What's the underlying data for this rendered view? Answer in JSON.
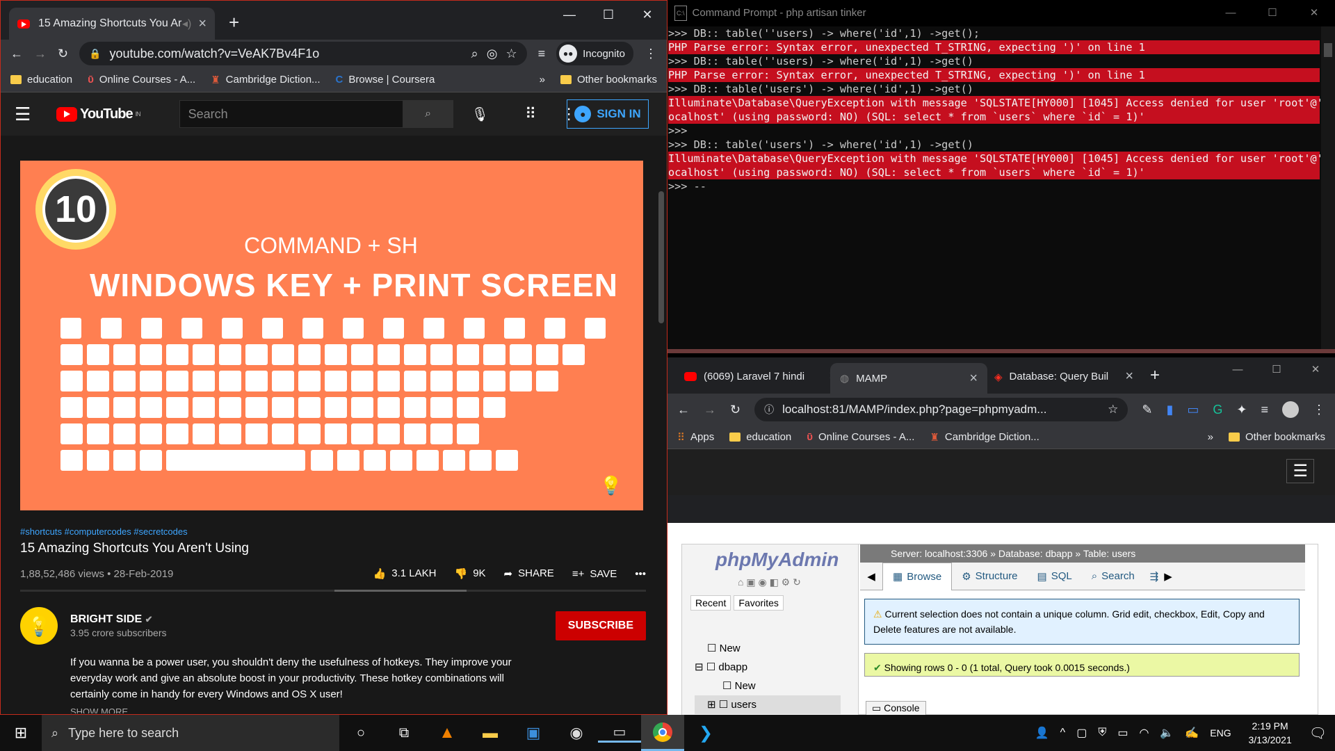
{
  "youtube_window": {
    "tab_title": "15 Amazing Shortcuts You Ar",
    "url": "youtube.com/watch?v=VeAK7Bv4F1o",
    "incognito_label": "Incognito",
    "bookmarks": [
      "education",
      "Online Courses - A...",
      "Cambridge Diction...",
      "Browse | Coursera"
    ],
    "other_bookmarks": "Other bookmarks",
    "yt_logo": "YouTube",
    "yt_region": "IN",
    "search_placeholder": "Search",
    "signin": "SIGN IN",
    "thumb": {
      "badge": "10",
      "line1": "COMMAND + SH",
      "line2": "WINDOWS KEY + PRINT SCREEN"
    },
    "hashtags": "#shortcuts #computercodes #secretcodes",
    "title": "15 Amazing Shortcuts You Aren't Using",
    "meta": "1,88,52,486 views • 28-Feb-2019",
    "likes": "3.1 LAKH",
    "dislikes": "9K",
    "share": "SHARE",
    "save": "SAVE",
    "channel": "BRIGHT SIDE",
    "subs": "3.95 crore subscribers",
    "subscribe": "SUBSCRIBE",
    "desc": "If you wanna be a power user, you shouldn't deny the usefulness of hotkeys. They improve your everyday work and give an absolute boost in your productivity. These hotkey combinations will certainly come in handy for every Windows and OS X user!",
    "show_more": "SHOW MORE"
  },
  "cmd_window": {
    "title": "Command Prompt - php  artisan tinker",
    "lines": [
      {
        "t": ">>> DB:: table(''users) -> where('id',1) ->get();",
        "e": false
      },
      {
        "t": "PHP Parse error: Syntax error, unexpected T_STRING, expecting ')' on line 1",
        "e": true
      },
      {
        "t": ">>> DB:: table(''users) -> where('id',1) ->get()",
        "e": false
      },
      {
        "t": "PHP Parse error: Syntax error, unexpected T_STRING, expecting ')' on line 1",
        "e": true
      },
      {
        "t": ">>> DB:: table('users') -> where('id',1) ->get()",
        "e": false
      },
      {
        "t": "Illuminate\\Database\\QueryException with message 'SQLSTATE[HY000] [1045] Access denied for user 'root'@'l",
        "e": true
      },
      {
        "t": "ocalhost' (using password: NO) (SQL: select * from `users` where `id` = 1)'",
        "e": true
      },
      {
        "t": ">>>",
        "e": false
      },
      {
        "t": ">>> DB:: table('users') -> where('id',1) ->get()",
        "e": false
      },
      {
        "t": "Illuminate\\Database\\QueryException with message 'SQLSTATE[HY000] [1045] Access denied for user 'root'@'l",
        "e": true
      },
      {
        "t": "ocalhost' (using password: NO) (SQL: select * from `users` where `id` = 1)'",
        "e": true
      },
      {
        "t": ">>> --",
        "e": false
      }
    ]
  },
  "mamp_window": {
    "tabs": [
      "(6069) Laravel 7 hindi",
      "MAMP",
      "Database: Query Buil"
    ],
    "url": "localhost:81/MAMP/index.php?page=phpmyadm...",
    "bookmarks": [
      "Apps",
      "education",
      "Online Courses - A...",
      "Cambridge Diction..."
    ],
    "other_bookmarks": "Other bookmarks",
    "pma_logo": "phpMyAdmin",
    "recent": "Recent",
    "favorites": "Favorites",
    "tree": [
      "New",
      "dbapp",
      "New",
      "users"
    ],
    "breadcrumb": "Server: localhost:3306 » Database: dbapp » Table: users",
    "pma_tabs": [
      "Browse",
      "Structure",
      "SQL",
      "Search"
    ],
    "notice": "Current selection does not contain a unique column. Grid edit, checkbox, Edit, Copy and Delete features are not available.",
    "success": "Showing rows 0 - 0 (1 total, Query took 0.0015 seconds.)",
    "console": "Console"
  },
  "taskbar": {
    "search": "Type here to search",
    "lang": "ENG",
    "time": "2:19 PM",
    "date": "3/13/2021"
  }
}
